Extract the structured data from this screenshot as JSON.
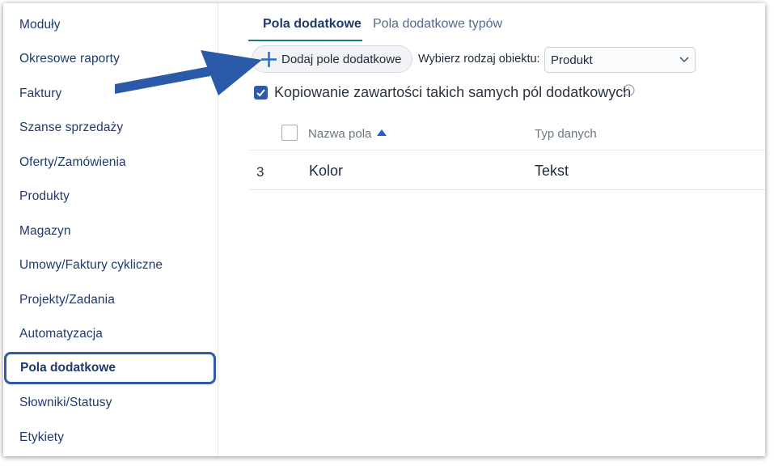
{
  "sidebar": {
    "items": [
      {
        "label": "Moduły"
      },
      {
        "label": "Okresowe raporty"
      },
      {
        "label": "Faktury"
      },
      {
        "label": "Szanse sprzedaży"
      },
      {
        "label": "Oferty/Zamówienia"
      },
      {
        "label": "Produkty"
      },
      {
        "label": "Magazyn"
      },
      {
        "label": "Umowy/Faktury cykliczne"
      },
      {
        "label": "Projekty/Zadania"
      },
      {
        "label": "Automatyzacja"
      },
      {
        "label": "Pola dodatkowe"
      },
      {
        "label": "Słowniki/Statusy"
      },
      {
        "label": "Etykiety"
      }
    ],
    "active_index": 10
  },
  "tabs": [
    {
      "label": "Pola dodatkowe",
      "active": true
    },
    {
      "label": "Pola dodatkowe typów",
      "active": false
    }
  ],
  "toolbar": {
    "add_button_label": "Dodaj pole dodatkowe",
    "object_type_label": "Wybierz rodzaj obiektu:",
    "object_type_value": "Produkt"
  },
  "copy_option": {
    "label": "Kopiowanie zawartości takich samych pól dodatkowych",
    "checked": true
  },
  "table": {
    "columns": [
      "Nazwa pola",
      "Typ danych"
    ],
    "sort": "ascending",
    "rows": [
      {
        "id": "3",
        "name": "Kolor",
        "type": "Tekst"
      }
    ]
  },
  "colors": {
    "accent": "#2e5aa8",
    "tab_underline": "#1f7a87",
    "annotation_arrow": "#2b5ba8"
  },
  "icons": {
    "add": "plus-icon",
    "select": "chevron-down-icon",
    "info": "info-icon",
    "sort": "sort-ascending-icon",
    "annotation": "arrow-annotation-icon"
  }
}
